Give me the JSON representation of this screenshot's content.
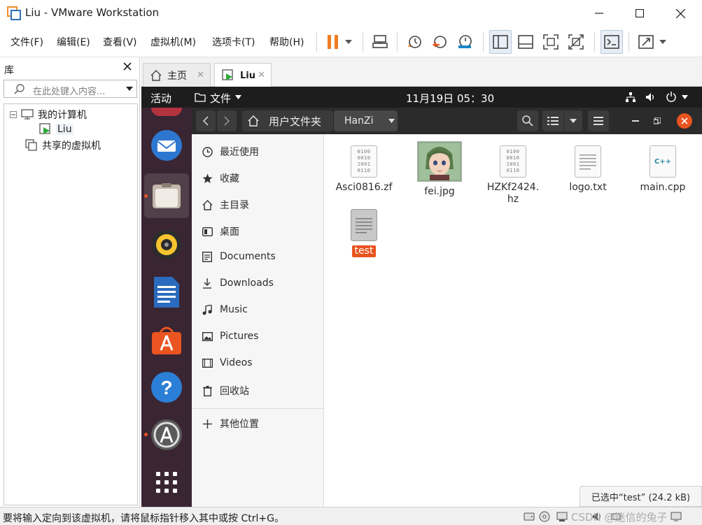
{
  "window": {
    "title": "Liu - VMware Workstation"
  },
  "menu": {
    "items": [
      "文件(F)",
      "编辑(E)",
      "查看(V)",
      "虚拟机(M)",
      "选项卡(T)",
      "帮助(H)"
    ]
  },
  "library": {
    "title": "库",
    "search_placeholder": "在此处键入内容...",
    "tree": {
      "my_computer": "我的计算机",
      "vm": "Liu",
      "shared": "共享的虚拟机"
    }
  },
  "tabs": [
    {
      "label": "主页"
    },
    {
      "label": "Liu"
    }
  ],
  "guest": {
    "topbar": {
      "activities": "活动",
      "app_menu": "文件",
      "clock": "11月19日 05：30"
    },
    "path": {
      "home_label": "用户文件夹",
      "current": "HanZi"
    },
    "sidebar": [
      {
        "label": "最近使用",
        "icon": "clock-icon"
      },
      {
        "label": "收藏",
        "icon": "star-icon"
      },
      {
        "label": "主目录",
        "icon": "home-icon"
      },
      {
        "label": "桌面",
        "icon": "desktop-icon"
      },
      {
        "label": "Documents",
        "icon": "document-icon"
      },
      {
        "label": "Downloads",
        "icon": "download-icon"
      },
      {
        "label": "Music",
        "icon": "music-icon"
      },
      {
        "label": "Pictures",
        "icon": "picture-icon"
      },
      {
        "label": "Videos",
        "icon": "video-icon"
      },
      {
        "label": "回收站",
        "icon": "trash-icon"
      },
      {
        "label": "其他位置",
        "icon": "plus-icon"
      }
    ],
    "files": [
      {
        "name": "Asci0816.zf",
        "type": "binary"
      },
      {
        "name": "fei.jpg",
        "type": "image"
      },
      {
        "name": "HZKf2424.\nhz",
        "type": "binary"
      },
      {
        "name": "logo.txt",
        "type": "text"
      },
      {
        "name": "main.cpp",
        "type": "cpp"
      },
      {
        "name": "test",
        "type": "text",
        "selected": true
      }
    ],
    "cpp_badge": "C++",
    "binary_lines": [
      "0100",
      "0010",
      "1001",
      "0110"
    ],
    "selection_status": "已选中“test” (24.2 kB)"
  },
  "statusbar": {
    "message": "要将输入定向到该虚拟机，请将鼠标指针移入其中或按 Ctrl+G。",
    "watermark": "CSDN @迷信的兔子"
  },
  "colors": {
    "accent": "#e95420",
    "dock_bg": "#3a2532",
    "topbar_bg": "#1d1d1d",
    "pause": "#f07c22"
  }
}
